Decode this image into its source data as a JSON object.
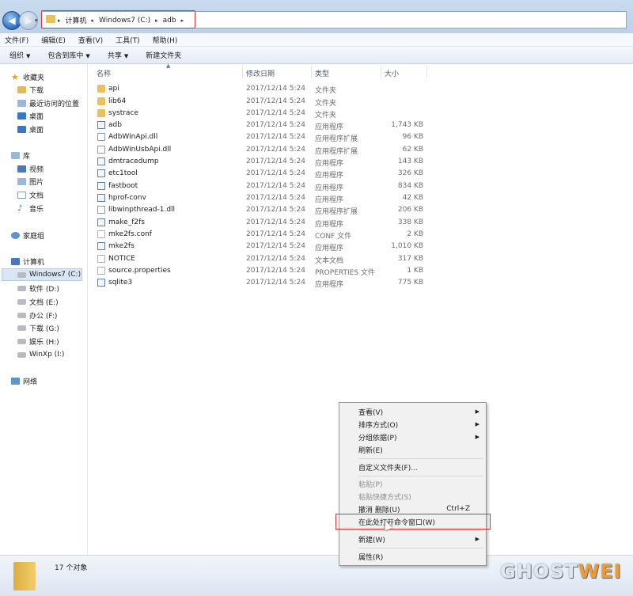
{
  "address": {
    "crumbs": [
      "计算机",
      "Windows7 (C:)",
      "adb"
    ]
  },
  "menu": [
    "文件(F)",
    "编辑(E)",
    "查看(V)",
    "工具(T)",
    "帮助(H)"
  ],
  "toolbar": {
    "organize": "组织",
    "include": "包含到库中",
    "share": "共享",
    "new_folder": "新建文件夹"
  },
  "sidebar": {
    "favorites": {
      "label": "收藏夹",
      "items": [
        "下载",
        "最近访问的位置",
        "桌面",
        "桌面"
      ]
    },
    "libraries": {
      "label": "库",
      "items": [
        "视频",
        "图片",
        "文档",
        "音乐"
      ]
    },
    "homegroup": "家庭组",
    "computer": {
      "label": "计算机",
      "drives": [
        "Windows7 (C:)",
        "软件 (D:)",
        "文档 (E:)",
        "办公 (F:)",
        "下载 (G:)",
        "娱乐 (H:)",
        "WinXp (I:)"
      ]
    },
    "network": "网络"
  },
  "columns": {
    "name": "名称",
    "date": "修改日期",
    "type": "类型",
    "size": "大小"
  },
  "files": [
    {
      "name": "api",
      "date": "2017/12/14 5:24",
      "type": "文件夹",
      "size": "",
      "icon": "folder"
    },
    {
      "name": "lib64",
      "date": "2017/12/14 5:24",
      "type": "文件夹",
      "size": "",
      "icon": "folder"
    },
    {
      "name": "systrace",
      "date": "2017/12/14 5:24",
      "type": "文件夹",
      "size": "",
      "icon": "folder"
    },
    {
      "name": "adb",
      "date": "2017/12/14 5:24",
      "type": "应用程序",
      "size": "1,743 KB",
      "icon": "app"
    },
    {
      "name": "AdbWinApi.dll",
      "date": "2017/12/14 5:24",
      "type": "应用程序扩展",
      "size": "96 KB",
      "icon": "dll"
    },
    {
      "name": "AdbWinUsbApi.dll",
      "date": "2017/12/14 5:24",
      "type": "应用程序扩展",
      "size": "62 KB",
      "icon": "dll"
    },
    {
      "name": "dmtracedump",
      "date": "2017/12/14 5:24",
      "type": "应用程序",
      "size": "143 KB",
      "icon": "app"
    },
    {
      "name": "etc1tool",
      "date": "2017/12/14 5:24",
      "type": "应用程序",
      "size": "326 KB",
      "icon": "app"
    },
    {
      "name": "fastboot",
      "date": "2017/12/14 5:24",
      "type": "应用程序",
      "size": "834 KB",
      "icon": "app"
    },
    {
      "name": "hprof-conv",
      "date": "2017/12/14 5:24",
      "type": "应用程序",
      "size": "42 KB",
      "icon": "app"
    },
    {
      "name": "libwinpthread-1.dll",
      "date": "2017/12/14 5:24",
      "type": "应用程序扩展",
      "size": "206 KB",
      "icon": "dll"
    },
    {
      "name": "make_f2fs",
      "date": "2017/12/14 5:24",
      "type": "应用程序",
      "size": "338 KB",
      "icon": "app"
    },
    {
      "name": "mke2fs.conf",
      "date": "2017/12/14 5:24",
      "type": "CONF 文件",
      "size": "2 KB",
      "icon": "file"
    },
    {
      "name": "mke2fs",
      "date": "2017/12/14 5:24",
      "type": "应用程序",
      "size": "1,010 KB",
      "icon": "app"
    },
    {
      "name": "NOTICE",
      "date": "2017/12/14 5:24",
      "type": "文本文档",
      "size": "317 KB",
      "icon": "file"
    },
    {
      "name": "source.properties",
      "date": "2017/12/14 5:24",
      "type": "PROPERTIES 文件",
      "size": "1 KB",
      "icon": "file"
    },
    {
      "name": "sqlite3",
      "date": "2017/12/14 5:24",
      "type": "应用程序",
      "size": "775 KB",
      "icon": "app"
    }
  ],
  "status": {
    "count": "17 个对象"
  },
  "context_menu": {
    "view": "查看(V)",
    "sort": "排序方式(O)",
    "group": "分组依据(P)",
    "refresh": "刷新(E)",
    "customize": "自定义文件夹(F)...",
    "paste": "粘贴(P)",
    "paste_shortcut": "粘贴快捷方式(S)",
    "undo": "撤消 删除(U)",
    "undo_shortcut": "Ctrl+Z",
    "open_cmd": "在此处打开命令窗口(W)",
    "new": "新建(W)",
    "properties": "属性(R)"
  },
  "logo": {
    "part1": "GHOST",
    "part2": "WEI"
  }
}
